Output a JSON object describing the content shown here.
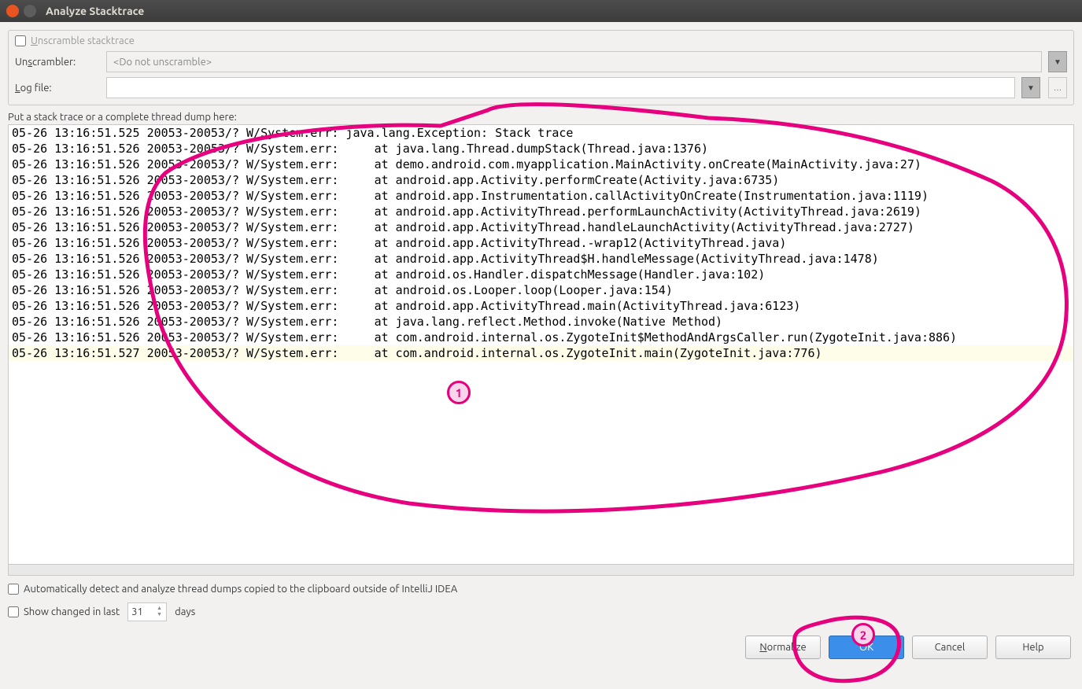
{
  "window": {
    "title": "Analyze Stacktrace"
  },
  "topPanel": {
    "unscrambleCheckbox": "Unscramble stacktrace",
    "unscramblerLabel": "Unscrambler:",
    "unscramblerValue": "<Do not unscramble>",
    "logFileLabel": "Log file:",
    "logFileValue": ""
  },
  "instruction": "Put a stack trace or a complete thread dump here:",
  "trace": [
    "05-26 13:16:51.525 20053-20053/? W/System.err: java.lang.Exception: Stack trace",
    "05-26 13:16:51.526 20053-20053/? W/System.err:     at java.lang.Thread.dumpStack(Thread.java:1376)",
    "05-26 13:16:51.526 20053-20053/? W/System.err:     at demo.android.com.myapplication.MainActivity.onCreate(MainActivity.java:27)",
    "05-26 13:16:51.526 20053-20053/? W/System.err:     at android.app.Activity.performCreate(Activity.java:6735)",
    "05-26 13:16:51.526 20053-20053/? W/System.err:     at android.app.Instrumentation.callActivityOnCreate(Instrumentation.java:1119)",
    "05-26 13:16:51.526 20053-20053/? W/System.err:     at android.app.ActivityThread.performLaunchActivity(ActivityThread.java:2619)",
    "05-26 13:16:51.526 20053-20053/? W/System.err:     at android.app.ActivityThread.handleLaunchActivity(ActivityThread.java:2727)",
    "05-26 13:16:51.526 20053-20053/? W/System.err:     at android.app.ActivityThread.-wrap12(ActivityThread.java)",
    "05-26 13:16:51.526 20053-20053/? W/System.err:     at android.app.ActivityThread$H.handleMessage(ActivityThread.java:1478)",
    "05-26 13:16:51.526 20053-20053/? W/System.err:     at android.os.Handler.dispatchMessage(Handler.java:102)",
    "05-26 13:16:51.526 20053-20053/? W/System.err:     at android.os.Looper.loop(Looper.java:154)",
    "05-26 13:16:51.526 20053-20053/? W/System.err:     at android.app.ActivityThread.main(ActivityThread.java:6123)",
    "05-26 13:16:51.526 20053-20053/? W/System.err:     at java.lang.reflect.Method.invoke(Native Method)",
    "05-26 13:16:51.526 20053-20053/? W/System.err:     at com.android.internal.os.ZygoteInit$MethodAndArgsCaller.run(ZygoteInit.java:886)",
    "05-26 13:16:51.527 20053-20053/? W/System.err:     at com.android.internal.os.ZygoteInit.main(ZygoteInit.java:776)"
  ],
  "traceHighlightIndex": 14,
  "bottomChecks": {
    "autoDetect": "Automatically detect and analyze thread dumps copied to the clipboard outside of IntelliJ IDEA",
    "showChangedPrefix": "Show changed in last",
    "showChangedDays": "31",
    "showChangedSuffix": "days"
  },
  "buttons": {
    "normalize": "Normalize",
    "ok": "OK",
    "cancel": "Cancel",
    "help": "Help"
  },
  "annotations": {
    "label1": "1",
    "label2": "2"
  }
}
